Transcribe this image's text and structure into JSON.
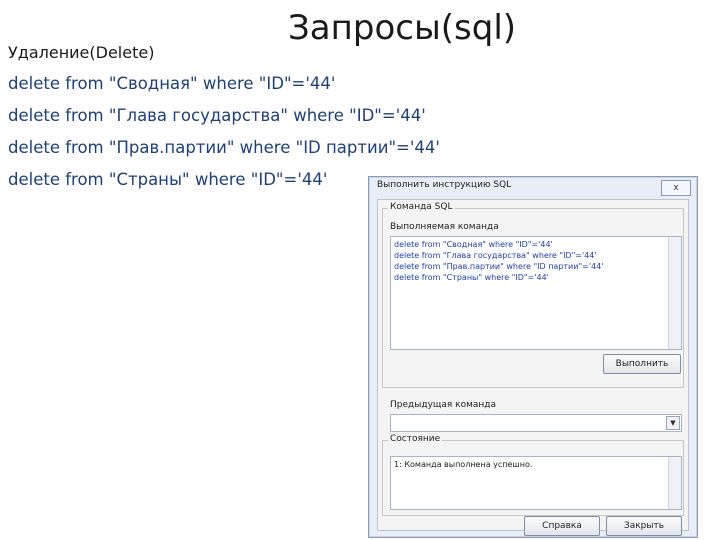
{
  "slide": {
    "title": "Запросы(sql)",
    "subtitle": "Удаление(Delete)",
    "lines": [
      "delete from \"Сводная\" where \"ID\"='44'",
      "delete from \"Глава государства\" where \"ID\"='44'",
      "delete from \"Прав.партии\" where \"ID партии\"='44'",
      "delete from \"Страны\" where \"ID\"='44'"
    ]
  },
  "dialog": {
    "title": "Выполнить инструкцию SQL",
    "close": "x",
    "command_group": "Команда SQL",
    "executed_label": "Выполняемая команда",
    "sql_lines": [
      "delete from \"Сводная\" where \"ID\"='44'",
      "delete from \"Глава государства\" where \"ID\"='44'",
      "delete from \"Прав.партии\" where \"ID партии\"='44'",
      "delete from \"Страны\" where \"ID\"='44'"
    ],
    "execute_button": "Выполнить",
    "previous_label": "Предыдущая команда",
    "combo_arrow": "▼",
    "status_label": "Состояние",
    "status_text": "1: Команда выполнена успешно.",
    "help_button": "Справка",
    "close_button": "Закрыть"
  }
}
